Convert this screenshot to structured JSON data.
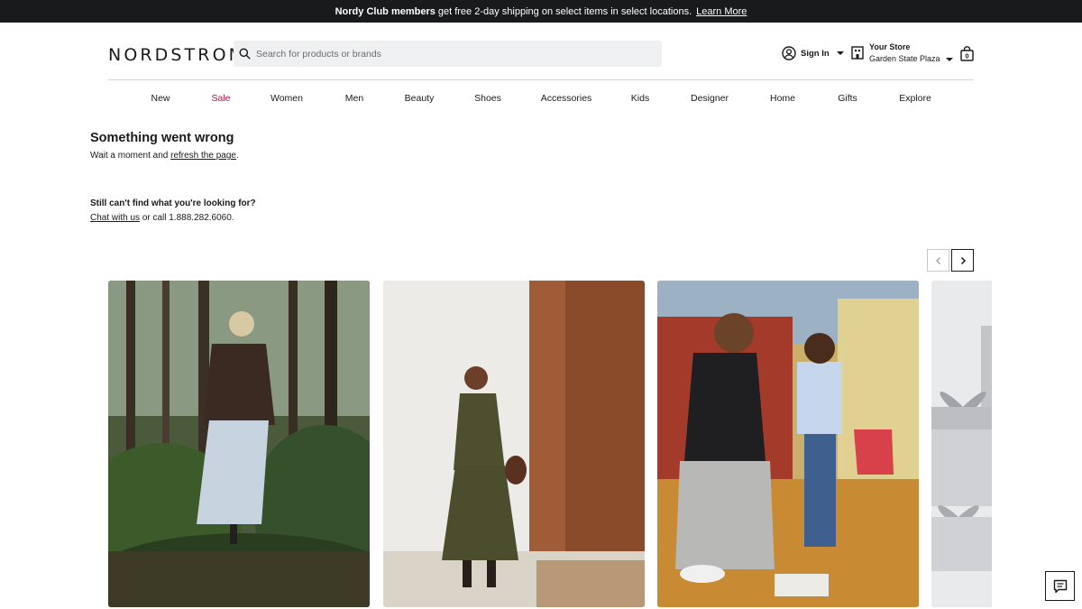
{
  "promo": {
    "bold": "Nordy Club members",
    "text": "get free 2-day shipping on select items in select locations.",
    "link": "Learn More"
  },
  "header": {
    "logo": "NORDSTROM",
    "search_placeholder": "Search for products or brands",
    "sign_in": "Sign In",
    "store_title": "Your Store",
    "store_name": "Garden State Plaza",
    "bag_count": "0"
  },
  "nav": [
    "New",
    "Sale",
    "Women",
    "Men",
    "Beauty",
    "Shoes",
    "Accessories",
    "Kids",
    "Designer",
    "Home",
    "Gifts",
    "Explore"
  ],
  "error": {
    "title": "Something went wrong",
    "msg_before": "Wait a moment and",
    "msg_link": "refresh the page",
    "msg_after": "."
  },
  "help": {
    "title": "Still can't find what you're looking for?",
    "link": "Chat with us",
    "text": "or call 1.888.282.6060."
  },
  "carousel": {
    "prev_icon": "chevron-left-icon",
    "next_icon": "chevron-right-icon"
  },
  "colors": {
    "promo_bg": "#191a1b",
    "sale": "#a8164b",
    "search_bg": "#eef0f2"
  }
}
